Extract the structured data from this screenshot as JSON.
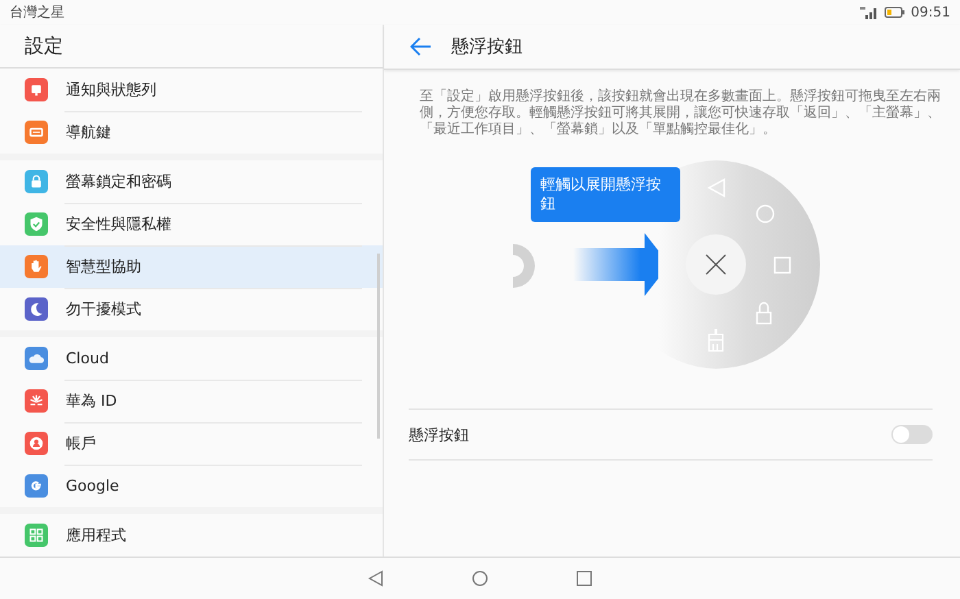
{
  "status_bar": {
    "carrier": "台灣之星",
    "time": "09:51"
  },
  "sidebar": {
    "title": "設定",
    "groups": [
      [
        {
          "label": "通知與狀態列",
          "color": "#f4574d",
          "selected": false
        },
        {
          "label": "導航鍵",
          "color": "#f6792f",
          "selected": false
        }
      ],
      [
        {
          "label": "螢幕鎖定和密碼",
          "color": "#3fb5e5",
          "selected": false
        },
        {
          "label": "安全性與隱私權",
          "color": "#45c66a",
          "selected": false
        },
        {
          "label": "智慧型協助",
          "color": "#f6792f",
          "selected": true
        },
        {
          "label": "勿干擾模式",
          "color": "#5b63c9",
          "selected": false
        }
      ],
      [
        {
          "label": "Cloud",
          "color": "#4a8ee0",
          "selected": false
        },
        {
          "label": "華為 ID",
          "color": "#f4574d",
          "selected": false
        },
        {
          "label": "帳戶",
          "color": "#f4574d",
          "selected": false
        },
        {
          "label": "Google",
          "color": "#4a8ee0",
          "selected": false
        }
      ],
      [
        {
          "label": "應用程式",
          "color": "#45c66a",
          "selected": false
        }
      ]
    ]
  },
  "detail": {
    "title": "懸浮按鈕",
    "description": "至「設定」啟用懸浮按鈕後，該按鈕就會出現在多數畫面上。懸浮按鈕可拖曳至左右兩側，方便您存取。輕觸懸浮按鈕可將其展開，讓您可快速存取「返回」、「主螢幕」、「最近工作項目」、「螢幕鎖」以及「單點觸控最佳化」。",
    "illustration": {
      "tooltip": "輕觸以展開懸浮按鈕"
    },
    "settings": [
      {
        "label": "懸浮按鈕",
        "on": false
      }
    ]
  }
}
